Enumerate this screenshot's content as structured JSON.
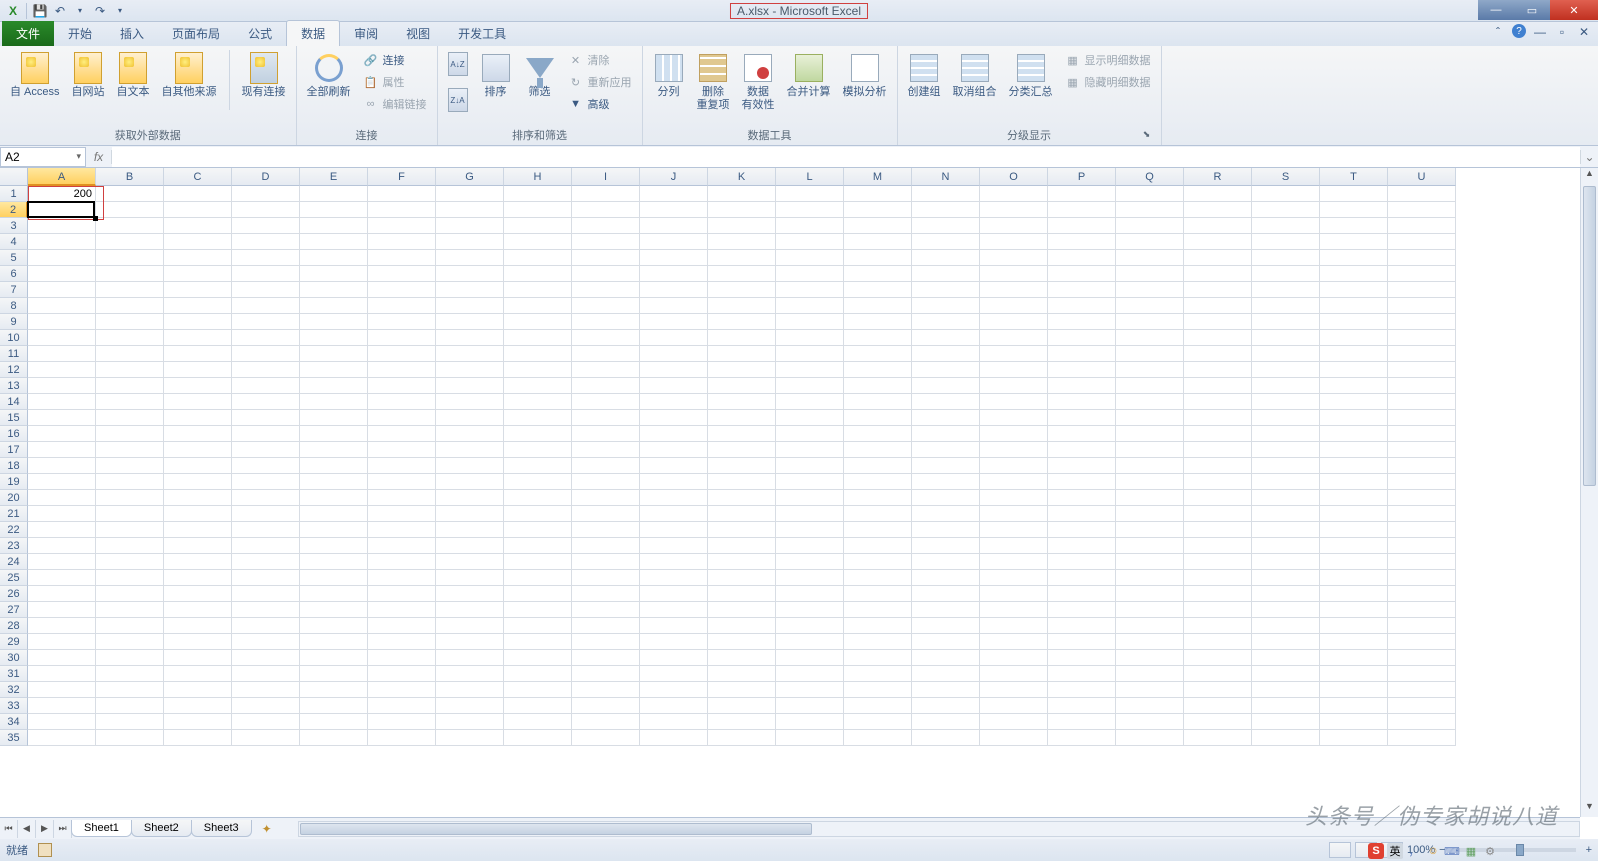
{
  "title": "A.xlsx - Microsoft Excel",
  "tabs": {
    "file": "文件",
    "home": "开始",
    "insert": "插入",
    "layout": "页面布局",
    "formulas": "公式",
    "data": "数据",
    "review": "审阅",
    "view": "视图",
    "dev": "开发工具"
  },
  "ribbon": {
    "getExternal": {
      "access": "自 Access",
      "web": "自网站",
      "text": "自文本",
      "other": "自其他来源",
      "existing": "现有连接",
      "label": "获取外部数据"
    },
    "connections": {
      "refreshAll": "全部刷新",
      "connections": "连接",
      "properties": "属性",
      "editLinks": "编辑链接",
      "label": "连接"
    },
    "sortFilter": {
      "sortAZ": "↓",
      "sortZA": "↓",
      "sort": "排序",
      "filter": "筛选",
      "clear": "清除",
      "reapply": "重新应用",
      "advanced": "高级",
      "label": "排序和筛选"
    },
    "dataTools": {
      "textToCol": "分列",
      "removeDup": "删除\n重复项",
      "validation": "数据\n有效性",
      "consolidate": "合并计算",
      "whatIf": "模拟分析",
      "label": "数据工具"
    },
    "outline": {
      "group": "创建组",
      "ungroup": "取消组合",
      "subtotal": "分类汇总",
      "showDetail": "显示明细数据",
      "hideDetail": "隐藏明细数据",
      "label": "分级显示"
    }
  },
  "nameBox": "A2",
  "formula": "",
  "columns": [
    "A",
    "B",
    "C",
    "D",
    "E",
    "F",
    "G",
    "H",
    "I",
    "J",
    "K",
    "L",
    "M",
    "N",
    "O",
    "P",
    "Q",
    "R",
    "S",
    "T",
    "U"
  ],
  "rowCount": 35,
  "cellData": {
    "A1": "200"
  },
  "activeCell": "A2",
  "selectedCol": "A",
  "selectedRow": 2,
  "sheets": [
    "Sheet1",
    "Sheet2",
    "Sheet3"
  ],
  "activeSheet": "Sheet1",
  "status": {
    "ready": "就绪",
    "zoom": "100%"
  },
  "watermark": "头条号／伪专家胡说八道",
  "ime": "英"
}
